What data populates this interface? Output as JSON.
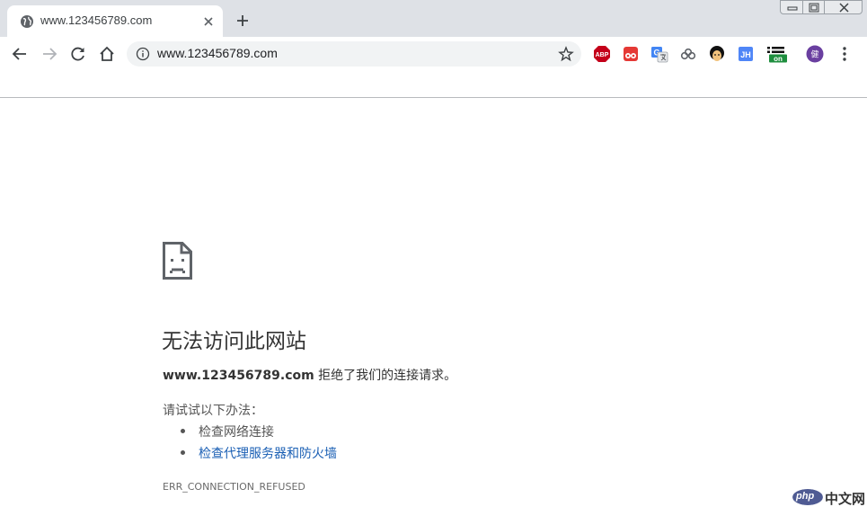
{
  "tab": {
    "title": "www.123456789.com"
  },
  "toolbar": {
    "url": "www.123456789.com",
    "extensions": [
      {
        "name": "adblock-plus-icon",
        "label": "ABP",
        "color": "#c4001a"
      },
      {
        "name": "tampermonkey-icon",
        "label": "",
        "color": "#e53935"
      },
      {
        "name": "google-translate-icon",
        "label": "",
        "color": "#4285f4"
      },
      {
        "name": "cloud-extension-icon",
        "label": "",
        "color": "#5f6368"
      },
      {
        "name": "avatar-extension-icon",
        "label": "",
        "color": "#111111"
      },
      {
        "name": "jh-extension-icon",
        "label": "JH",
        "color": "#4f86f7"
      },
      {
        "name": "on-extension-icon",
        "label": "on",
        "color": "#1e8e3e"
      },
      {
        "name": "profile-avatar",
        "label": "健",
        "color": "#6a3fa0"
      }
    ]
  },
  "error": {
    "title": "无法访问此网站",
    "host": "www.123456789.com",
    "summary_suffix": " 拒绝了我们的连接请求。",
    "try_label": "请试试以下办法：",
    "suggestions": [
      {
        "text": "检查网络连接",
        "link": false
      },
      {
        "text": "检查代理服务器和防火墙",
        "link": true
      }
    ],
    "code": "ERR_CONNECTION_REFUSED"
  },
  "watermark": {
    "logo_text": "php",
    "site_text": "中文网"
  },
  "colors": {
    "tabstrip": "#dee1e6",
    "link": "#1a5fb4",
    "text": "#333333"
  }
}
